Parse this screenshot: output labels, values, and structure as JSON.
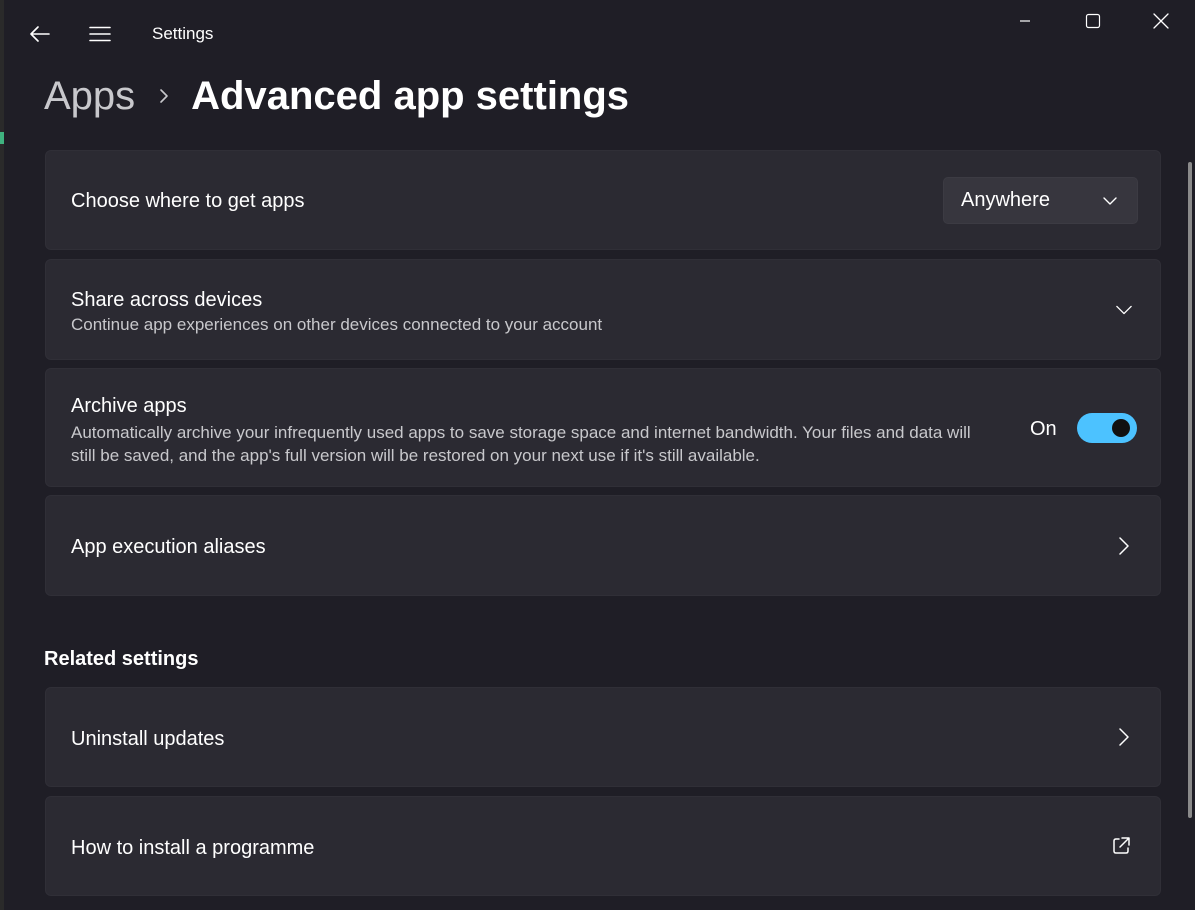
{
  "window": {
    "title": "Settings"
  },
  "breadcrumb": {
    "parent": "Apps",
    "current": "Advanced app settings"
  },
  "settings": {
    "get_apps": {
      "title": "Choose where to get apps",
      "dropdown_value": "Anywhere"
    },
    "share_devices": {
      "title": "Share across devices",
      "description": "Continue app experiences on other devices connected to your account"
    },
    "archive_apps": {
      "title": "Archive apps",
      "description": "Automatically archive your infrequently used apps to save storage space and internet bandwidth. Your files and data will still be saved, and the app's full version will be restored on your next use if it's still available.",
      "toggle_label": "On",
      "toggle_on": true
    },
    "aliases": {
      "title": "App execution aliases"
    }
  },
  "related": {
    "heading": "Related settings",
    "items": [
      {
        "title": "Uninstall updates",
        "icon": "chevron-right-icon"
      },
      {
        "title": "How to install a programme",
        "icon": "external-link-icon"
      }
    ]
  },
  "colors": {
    "accent": "#4cc2ff",
    "background": "#1f1e26",
    "card": "#2b2a32"
  }
}
